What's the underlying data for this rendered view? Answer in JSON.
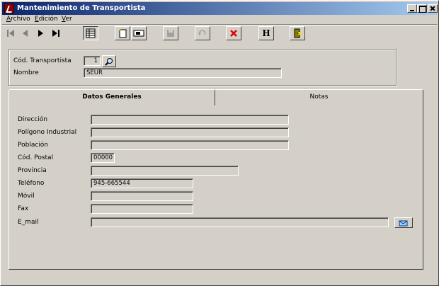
{
  "window": {
    "title": "Mantenimiento de Transportista"
  },
  "menu": [
    {
      "label": "Archivo",
      "accel": "A",
      "rest": "rchivo"
    },
    {
      "label": "Edición",
      "accel": "E",
      "rest": "dición"
    },
    {
      "label": "Ver",
      "accel": "V",
      "rest": "er"
    }
  ],
  "toolbar": {
    "help_label": "H"
  },
  "header": {
    "cod_label": "Cód. Transportista",
    "cod_value": "1",
    "nombre_label": "Nombre",
    "nombre_value": "SEUR"
  },
  "tabs": [
    {
      "label": "Datos Generales",
      "active": true
    },
    {
      "label": "Notas",
      "active": false
    }
  ],
  "form": {
    "direccion_label": "Dirección",
    "direccion_value": "",
    "poligono_label": "Polígono Industrial",
    "poligono_value": "",
    "poblacion_label": "Población",
    "poblacion_value": "",
    "cp_label": "Cód. Postal",
    "cp_value": "00000",
    "provincia_label": "Provincia",
    "provincia_value": "",
    "telefono_label": "Teléfono",
    "telefono_value": "945-665544",
    "movil_label": "Móvil",
    "movil_value": "",
    "fax_label": "Fax",
    "fax_value": "",
    "email_label": "E_mail",
    "email_value": ""
  },
  "colors": {
    "titlebar_start": "#0a246a",
    "face": "#d4d0c8",
    "delete_red": "#e00000"
  }
}
